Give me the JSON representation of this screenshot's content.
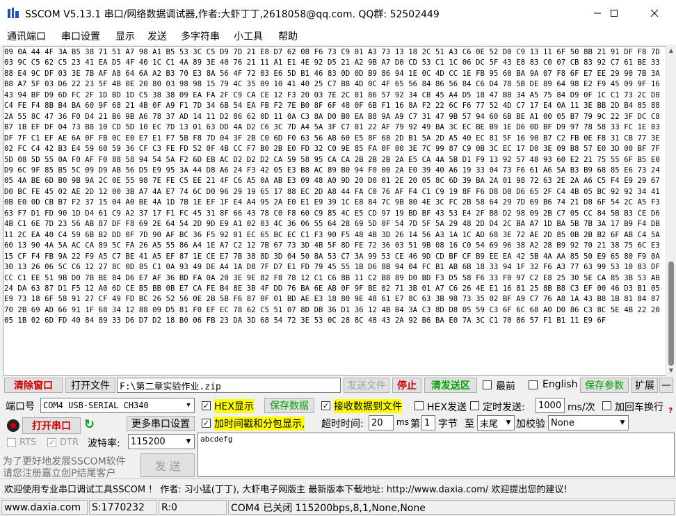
{
  "window": {
    "title": "SSCOM V5.13.1 串口/网络数据调试器,作者:大虾丁丁,2618058@qq.com. QQ群: 52502449",
    "min_icon": "minimize-icon",
    "max_icon": "maximize-icon",
    "close_icon": "close-icon"
  },
  "menu": [
    "通讯端口",
    "串口设置",
    "显示",
    "发送",
    "多字符串",
    "小工具",
    "帮助"
  ],
  "receive": {
    "text": "09 0A 44 4F 3A B5 38 71 51 A7 98 A1 B5 53 3C C5 D9 7D 21 E8 D7 62 08 F6 73 C9 01 A3 73 13 18 2C 51 A3 C6 0E 52 D0 C9 13 11 6F 50 8B 21 91 DF F8 7D 03 9C C5 62 C5 23 41 EA D5 4F 40 1C C1 4A 89 3E 40 76 21 11 A1 E1 4E 92 D5 21 A2 9B A7 D0 CD 53 C1 1C 06 DC 5F 43 E8 83 C0 07 CB 83 92 C7 61 BE 33 88 E4 9C DF 03 3E 7B AF A8 64 6A A2 B3 70 E3 8A 56 4F 72 03 E6 5D B1 46 83 0D 0D B9 86 94 1E 0C 4D CC 1E FB 95 60 BA 9A 07 F8 6F E7 EE 29 90 7B 3A B8 A7 5F 03 D6 22 23 5F 4B 0E 20 80 03 98 98 15 79 4C 35 09 10 41 40 25 C7 B8 4D 0C 4F 65 56 84 86 56 84 C6 D4 78 5B DE 89 64 98 E2 F9 45 09 9F 16 43 94 BF D9 6D FC 2F 1D BD 1D C5 38 38 09 EA FA 2F C9 CA CE 12 F3 20 03 7E 2C 81 86 57 92 34 CB 45 A4 D5 18 47 B8 34 A5 75 84 D9 0F 1C C1 73 2C D8 C4 FE F4 8B B4 BA 60 9F 68 21 4B 0F A9 F1 7D 34 6B 54 EA FB F2 7E B0 8F 6F 48 0F 6B F1 16 8A F2 22 6C F6 77 52 4D C7 17 E4 0A 11 3E BB 2D B4 85 88 2A 55 8C 47 36 F0 D4 21 B6 9B A6 78 37 AD 14 11 D2 86 62 0D 11 0A C3 8A D0 B0 EA B8 9A A9 C7 31 47 9B 57 94 60 6B BE A1 00 05 B7 79 9C 22 3F DC C8 B7 1B EF DF 04 73 B8 10 CD 5D 10 EC 7D 13 01 63 DD 4A D2 C6 3C 7D A4 5A 3F C7 81 22 AF 79 92 49 BA 3C EC BE B9 1E D6 0D BF D9 97 78 58 33 FC 1E 83 DF 7F C1 EF AE 6A 0F FB 0C E0 E7 E1 F7 5B F8 7D 04 3F 2B C0 6D F0 63 56 AB 60 E5 8F 68 2D B1 5A 2D A5 40 EC 81 5F 16 90 B7 C2 FB 0E F8 31 CB 77 3E 02 FC C4 42 B3 E4 59 60 59 36 CF C3 FE FD 52 0F 4B CC F7 B0 2B E0 FD 32 C0 9E 85 FA 0F 00 3E 7C 99 87 C9 0B 3C EC 17 D0 3E 09 B8 57 E0 3D 00 BF 7F 5D 08 5D 55 0A F0 AF F0 88 58 94 54 5A F2 6D EB AC D2 D2 D2 CA 59 58 95 CA CA 2B 2B 2B 2A E5 CA 4A 5B D1 F9 13 92 57 48 93 60 E2 21 75 55 6F B5 E0 D9 6C 9F 85 B5 5C 09 D9 AB 56 D5 E9 95 3A 44 D8 A6 24 F3 42 05 E3 B8 AC 89 B0 94 F0 00 2A E0 39 40 A6 19 33 04 73 F6 61 A6 5A B3 B9 68 85 E6 73 24 05 4A BE 6D B0 9B 9A 2C 0E 55 98 7E FE C5 EE 21 4F C6 A5 0A AB E3 09 48 A0 9D 20 D0 01 2E 20 05 8C 6D 39 BA 2A 01 98 72 63 2E 2A A6 C5 F4 E9 29 67 D0 BC FE 45 02 AE 2D 12 00 3B A7 4A E7 74 6C D0 96 29 19 65 17 88 EC 2D A8 44 FA C0 76 AF F4 C1 C9 19 8F F6 D8 D0 D6 65 2F C4 4B 05 BC 92 92 34 41 0B E0 0D CB B7 F2 37 15 04 A0 BE 4A 1D 7B 1E EF 1F E4 A4 95 2A E0 E1 E9 39 1C E8 84 7C 9B 80 4E 3C FC 2B 58 64 29 7D 69 B6 74 21 D8 6F 54 2C A5 F3 63 F7 D1 FD 90 1D D4 61 C9 A2 37 17 F1 FC 45 31 8F 66 43 78 C0 F8 60 C9 85 4C E5 CD 97 19 BD BF 43 53 E4 2F B8 D2 98 09 2B C7 05 CC 84 5B B3 CE D6 4B C1 6E 7D 23 56 AB 87 DF F8 69 2E 64 54 2D 9D E9 A1 02 03 4C 36 06 55 64 28 69 5D 0F 54 7D 5F 5A 29 48 2D D4 2C BA A7 1D BA 5B 7B 3A 17 B9 F4 DB 11 2C EA 40 C4 59 6B B2 DD 0F 7D 90 AF BC 36 F5 92 01 EC 65 BC EC C1 F3 90 F5 48 4B 3D 26 14 56 A3 1A 1C AD 68 3E 72 AE 2D 85 0B 2B B2 6F AB C4 5A 60 13 90 4A 5A AC CA 89 5C FA 26 A5 55 86 A4 1E A7 C2 12 7B 67 73 3D 4B 5F 8D FE 72 36 03 51 9B 08 16 C0 54 69 96 38 A2 28 B9 92 70 21 38 75 6C E3 15 CF F4 FB 9A 22 F9 A5 C7 BE 41 A5 EF 87 1E CE E7 7B 38 8D 3D 04 50 8A 53 C7 3A 99 53 CE 46 9D CD BF CF B9 EE EA 42 5B 4A AA 85 50 E9 65 80 F9 0A 30 13 26 06 5C C6 12 27 8C 0D 85 C1 0A 93 49 DE A4 1A D8 7F D7 E1 FD 79 45 55 1B D6 8B 94 04 FC B1 AB 6B 18 33 94 1F 32 F6 A3 77 63 99 53 10 83 DF CC C1 EE 51 9B D0 7B BE 84 D6 E7 AF 36 BD FA 0A 20 3E 9E 82 F8 78 12 C1 C6 8B 11 C2 B8 89 D0 BD F3 D5 58 F6 33 F0 97 C2 E8 25 30 5E CA 85 3B 53 AB 24 DA 63 87 D1 F5 12 A0 6D CE B5 BB 0B E7 CA FE B4 8E 3B 4F DD 76 BA 6E AB 0F 9F BE 02 71 3B 01 A7 C6 26 4E E1 16 81 25 8B B8 C3 EF 00 46 D3 B1 05 E9 73 18 6F 58 91 27 CF 49 FD BC 26 52 56 0E 2B 5B F6 87 0F 01 BD AE E3 18 80 9E 48 61 E7 8C 63 3B 98 73 35 02 BF A9 C7 76 A8 1A 43 B8 1B 81 84 87 70 2B 69 AD 66 91 1F 68 34 12 88 09 D5 81 F0 EF EC 78 62 C5 51 07 8D DB 36 D1 36 12 4B B4 3A C3 8D D8 05 59 C3 6F 6C 68 A0 D0 86 C3 8C 5E 4B 22 20 05 1B 02 6D FD 40 84 89 33 D6 D7 D2 18 B0 06 FB 23 DA 3D 68 54 72 3E 53 0C 28 8C 48 43 2A 92 B6 BA E0 7A 3C C1 70 86 57 F1 B1 11 E9 6F"
  },
  "file_row": {
    "clear_label": "清除窗口",
    "open_file_label": "打开文件",
    "file_path": "F:\\第二章实验作业.zip",
    "send_file_label": "发送文件",
    "stop_label": "停止",
    "clear_send_label": "清发送区",
    "topmost_label": "最前",
    "english_label": "English",
    "save_params_label": "保存参数",
    "expand_label": "扩展",
    "dash_label": "—"
  },
  "port": {
    "port_label": "端口号",
    "port_value": "COM4 USB-SERIAL CH340",
    "more_settings_label": "更多串口设置",
    "open_label": "打开串口",
    "baud_label": "波特率:",
    "baud_value": "115200",
    "rts_label": "RTS",
    "dtr_label": "DTR",
    "promo_line1": "为了更好地发展SSCOM软件",
    "promo_line2": "请您注册嘉立创P结尾客户",
    "send_label": "发 送"
  },
  "options": {
    "hex_display": "HEX显示",
    "save_data": "保存数据",
    "recv_to_file": "接收数据到文件",
    "hex_send": "HEX发送",
    "timed_send": "定时发送:",
    "interval_value": "1000",
    "interval_unit": "ms/次",
    "add_newline": "加回车换行",
    "timestamp": "加时间戳和分包显示,",
    "timeout_label": "超时时间:",
    "timeout_value": "20",
    "timeout_unit": "ms",
    "nth_label": "第",
    "byte_value": "1",
    "byte_label": "字节",
    "to_label": "至",
    "end_value": "末尾",
    "checksum_label": "加校验",
    "checksum_value": "None",
    "help_mark": "?"
  },
  "send_box": {
    "text": "abcdefg"
  },
  "banner": {
    "text": "欢迎使用专业串口调试工具SSCOM ！   作者: 习小猛(丁丁), 大虾电子网版主   最新版本下载地址: http://www.daxia.com/ 欢迎提出您的建议!"
  },
  "statusbar": {
    "website": "www.daxia.com",
    "sent": "S:1770232",
    "received": "R:0",
    "port_status": "COM4 已关闭  115200bps,8,1,None,None"
  },
  "colors": {
    "red_text": "#cc0000",
    "green_text": "#00a000",
    "highlight": "#ffff00"
  }
}
